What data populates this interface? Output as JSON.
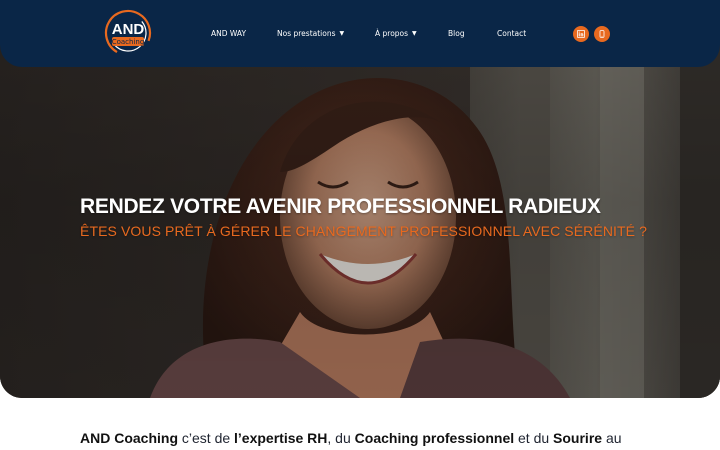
{
  "header": {
    "logo_text_top": "AND",
    "logo_text_bottom": "Coaching",
    "nav": {
      "and_way": "AND WAY",
      "prestations": "Nos prestations",
      "apropos": "À propos",
      "blog": "Blog",
      "contact": "Contact"
    },
    "social_icons": [
      "linkedin-icon",
      "phone-icon"
    ]
  },
  "hero": {
    "title": "RENDEZ VOTRE AVENIR PROFESSIONNEL RADIEUX",
    "subtitle": "ÊTES VOUS PRÊT À GÉRER LE CHANGEMENT PROFESSIONNEL AVEC SÉRÉNITÉ ?"
  },
  "intro": {
    "part1": "AND Coaching",
    "part2": " c’est de ",
    "part3": "l’expertise RH",
    "part4": ", du ",
    "part5": "Coaching professionnel",
    "part6": " et du ",
    "part7": "Sourire",
    "part8": " au"
  },
  "colors": {
    "header_bg": "#0a2647",
    "accent": "#e8691f",
    "hero_text": "#ffffff",
    "body_text": "#1f2430"
  }
}
